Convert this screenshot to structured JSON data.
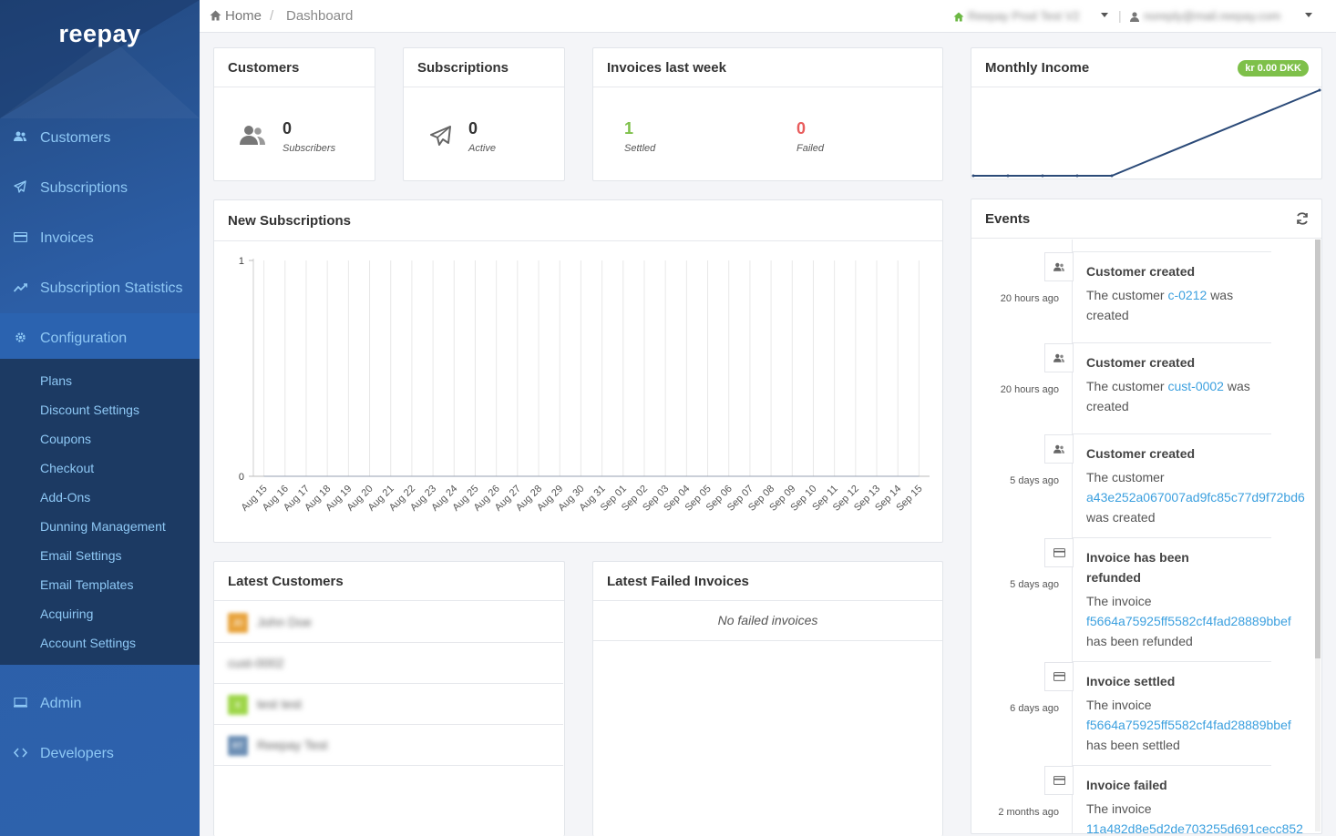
{
  "sidebar": {
    "logo": "reepay",
    "items": [
      {
        "label": "Customers",
        "icon": "users-icon"
      },
      {
        "label": "Subscriptions",
        "icon": "paper-plane-icon"
      },
      {
        "label": "Invoices",
        "icon": "credit-card-icon"
      },
      {
        "label": "Subscription Statistics",
        "icon": "trend-icon"
      },
      {
        "label": "Configuration",
        "icon": "gear-icon"
      }
    ],
    "config_items": [
      "Plans",
      "Discount Settings",
      "Coupons",
      "Checkout",
      "Add-Ons",
      "Dunning Management",
      "Email Settings",
      "Email Templates",
      "Acquiring",
      "Account Settings"
    ],
    "bottom_items": [
      {
        "label": "Admin",
        "icon": "monitor-icon"
      },
      {
        "label": "Developers",
        "icon": "code-icon"
      }
    ]
  },
  "topbar": {
    "home": "Home",
    "separator": "/",
    "current": "Dashboard",
    "account": "Reepay Prod Test V2",
    "user": "noreply@mail.reepay.com"
  },
  "customers_card": {
    "title": "Customers",
    "value": "0",
    "label": "Subscribers"
  },
  "subscriptions_card": {
    "title": "Subscriptions",
    "value": "0",
    "label": "Active"
  },
  "invoices_card": {
    "title": "Invoices last week",
    "settled_value": "1",
    "settled_label": "Settled",
    "failed_value": "0",
    "failed_label": "Failed"
  },
  "monthly_income": {
    "title": "Monthly Income",
    "badge": "kr 0.00 DKK"
  },
  "new_subscriptions": {
    "title": "New Subscriptions"
  },
  "chart_data": [
    {
      "type": "line",
      "title": "New Subscriptions",
      "xlabel": "",
      "ylabel": "",
      "x": [
        "Aug 15",
        "Aug 16",
        "Aug 17",
        "Aug 18",
        "Aug 19",
        "Aug 20",
        "Aug 21",
        "Aug 22",
        "Aug 23",
        "Aug 24",
        "Aug 25",
        "Aug 26",
        "Aug 27",
        "Aug 28",
        "Aug 29",
        "Aug 30",
        "Aug 31",
        "Sep 01",
        "Sep 02",
        "Sep 03",
        "Sep 04",
        "Sep 05",
        "Sep 06",
        "Sep 07",
        "Sep 08",
        "Sep 09",
        "Sep 10",
        "Sep 11",
        "Sep 12",
        "Sep 13",
        "Sep 14",
        "Sep 15"
      ],
      "values": [
        0,
        0,
        0,
        0,
        0,
        0,
        0,
        0,
        0,
        0,
        0,
        0,
        0,
        0,
        0,
        0,
        0,
        0,
        0,
        0,
        0,
        0,
        0,
        0,
        0,
        0,
        0,
        0,
        0,
        0,
        0,
        0
      ],
      "yticks": [
        "0",
        "1"
      ],
      "ylim": [
        0,
        1
      ],
      "grid": true
    },
    {
      "type": "line",
      "title": "Monthly Income",
      "values": [
        0,
        0,
        0,
        0,
        0,
        1
      ],
      "grid": false
    }
  ],
  "latest_customers": {
    "title": "Latest Customers",
    "rows": [
      {
        "initials": "JD",
        "name": "John Doe",
        "color": "#e8a33c"
      },
      {
        "initials": "",
        "name": "cust-0002",
        "color": ""
      },
      {
        "initials": "tt",
        "name": "test test",
        "color": "#9ed64a"
      },
      {
        "initials": "RT",
        "name": "Reepay Test",
        "color": "#6d8fb5"
      }
    ]
  },
  "latest_failed": {
    "title": "Latest Failed Invoices",
    "empty": "No failed invoices"
  },
  "events": {
    "title": "Events",
    "items": [
      {
        "time": "20 hours ago",
        "icon": "user-icon",
        "title": "Customer created",
        "pre": "The customer ",
        "link": "c-0212",
        "post": " was created"
      },
      {
        "time": "20 hours ago",
        "icon": "user-icon",
        "title": "Customer created",
        "pre": "The customer ",
        "link": "cust-0002",
        "post": "was created"
      },
      {
        "time": "5 days ago",
        "icon": "user-icon",
        "title": "Customer created",
        "pre": "The customer",
        "link": "a43e252a067007ad9fc85c77d9f72bd6",
        "post": "was created"
      },
      {
        "time": "5 days ago",
        "icon": "card-icon",
        "title": "Invoice has been",
        "title2": "refunded",
        "pre": "The invoice",
        "link": "f5664a75925ff5582cf4fad28889bbef",
        "post": "has been refunded"
      },
      {
        "time": "6 days ago",
        "icon": "card-icon",
        "title": "Invoice settled",
        "pre": "The invoice",
        "link": "f5664a75925ff5582cf4fad28889bbef",
        "post": "has been settled"
      },
      {
        "time": "2 months ago",
        "icon": "card-icon",
        "title": "Invoice failed",
        "pre": "The invoice",
        "link": "11a482d8e5d2de703255d691cecc852",
        "post": ""
      }
    ]
  },
  "colors": {
    "accent": "#3ca0df",
    "settled": "#7ec04a",
    "failed": "#e85c5c",
    "badge": "#7ec04a"
  }
}
